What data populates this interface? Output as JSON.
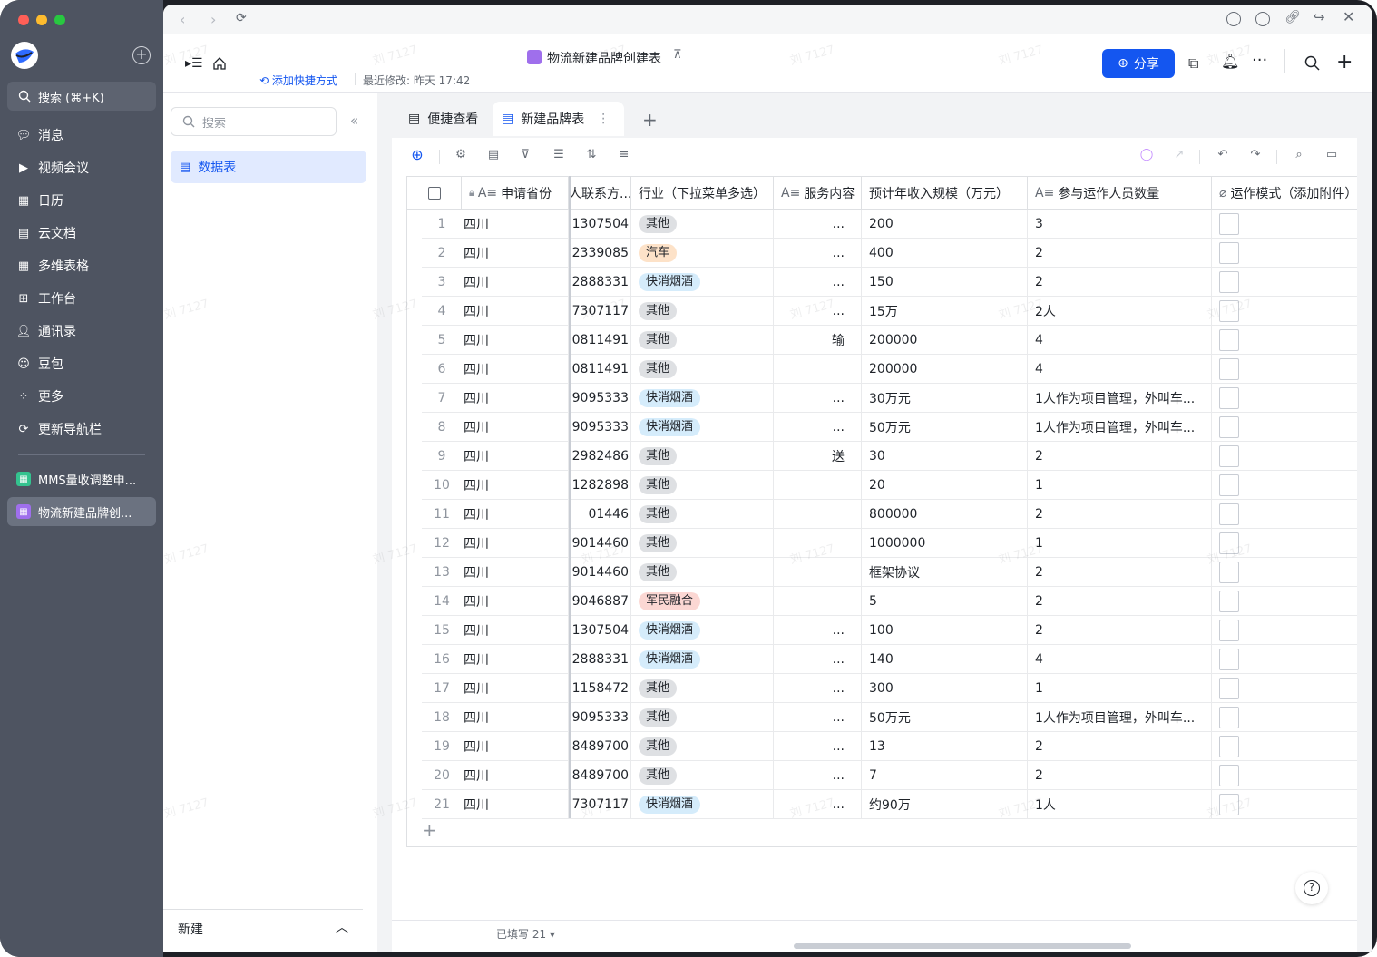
{
  "sidebar": {
    "search_label": "搜索 (⌘+K)",
    "items": [
      {
        "label": "消息",
        "icon": "message-icon"
      },
      {
        "label": "视频会议",
        "icon": "video-icon"
      },
      {
        "label": "日历",
        "icon": "calendar-icon"
      },
      {
        "label": "云文档",
        "icon": "doc-icon"
      },
      {
        "label": "多维表格",
        "icon": "base-icon"
      },
      {
        "label": "工作台",
        "icon": "workplace-icon"
      },
      {
        "label": "通讯录",
        "icon": "contacts-icon"
      },
      {
        "label": "豆包",
        "icon": "doubao-icon"
      },
      {
        "label": "更多",
        "icon": "more-icon"
      },
      {
        "label": "更新导航栏",
        "icon": "refresh-icon"
      }
    ],
    "pinned": [
      {
        "label": "MMS量收调整申...",
        "icon": "sheet-icon"
      },
      {
        "label": "物流新建品牌创...",
        "icon": "base-icon"
      }
    ]
  },
  "header": {
    "add_shortcut": "添加快捷方式",
    "last_modified": "最近修改: 昨天 17:42",
    "doc_title": "物流新建品牌创建表",
    "share_label": "分享"
  },
  "leftpanel": {
    "search_placeholder": "搜索",
    "table_item": "数据表",
    "new_label": "新建"
  },
  "tabs": [
    {
      "label": "便捷查看"
    },
    {
      "label": "新建品牌表"
    }
  ],
  "grid": {
    "columns": {
      "province": "申请省份",
      "contact": "人联系方...",
      "industry": "行业（下拉菜单多选）",
      "service": "服务内容",
      "revenue": "预计年收入规模（万元）",
      "staff": "参与运作人员数量",
      "mode": "运作模式（添加附件）"
    },
    "rows": [
      {
        "n": "1",
        "province": "四川",
        "contact": "1307504",
        "industry": "其他",
        "service": "...",
        "revenue": "200",
        "staff": "3"
      },
      {
        "n": "2",
        "province": "四川",
        "contact": "2339085",
        "industry": "汽车",
        "service": "...",
        "revenue": "400",
        "staff": "2"
      },
      {
        "n": "3",
        "province": "四川",
        "contact": "2888331",
        "industry": "快消烟酒",
        "service": "...",
        "revenue": "150",
        "staff": "2"
      },
      {
        "n": "4",
        "province": "四川",
        "contact": "7307117",
        "industry": "其他",
        "service": "...",
        "revenue": "15万",
        "staff": "2人"
      },
      {
        "n": "5",
        "province": "四川",
        "contact": "0811491",
        "industry": "其他",
        "service": "输",
        "revenue": "200000",
        "staff": "4"
      },
      {
        "n": "6",
        "province": "四川",
        "contact": "0811491",
        "industry": "其他",
        "service": "",
        "revenue": "200000",
        "staff": "4"
      },
      {
        "n": "7",
        "province": "四川",
        "contact": "9095333",
        "industry": "快消烟酒",
        "service": "...",
        "revenue": "30万元",
        "staff": "1人作为项目管理，外叫车..."
      },
      {
        "n": "8",
        "province": "四川",
        "contact": "9095333",
        "industry": "快消烟酒",
        "service": "...",
        "revenue": "50万元",
        "staff": "1人作为项目管理，外叫车..."
      },
      {
        "n": "9",
        "province": "四川",
        "contact": "2982486",
        "industry": "其他",
        "service": "送",
        "revenue": "30",
        "staff": "2"
      },
      {
        "n": "10",
        "province": "四川",
        "contact": "1282898",
        "industry": "其他",
        "service": "",
        "revenue": "20",
        "staff": "1"
      },
      {
        "n": "11",
        "province": "四川",
        "contact": "01446",
        "industry": "其他",
        "service": "",
        "revenue": "800000",
        "staff": "2"
      },
      {
        "n": "12",
        "province": "四川",
        "contact": "9014460",
        "industry": "其他",
        "service": "",
        "revenue": "1000000",
        "staff": "1"
      },
      {
        "n": "13",
        "province": "四川",
        "contact": "9014460",
        "industry": "其他",
        "service": "",
        "revenue": "框架协议",
        "staff": "2"
      },
      {
        "n": "14",
        "province": "四川",
        "contact": "9046887",
        "industry": "军民融合",
        "service": "",
        "revenue": "5",
        "staff": "2"
      },
      {
        "n": "15",
        "province": "四川",
        "contact": "1307504",
        "industry": "快消烟酒",
        "service": "...",
        "revenue": "100",
        "staff": "2"
      },
      {
        "n": "16",
        "province": "四川",
        "contact": "2888331",
        "industry": "快消烟酒",
        "service": "...",
        "revenue": "140",
        "staff": "4"
      },
      {
        "n": "17",
        "province": "四川",
        "contact": "1158472",
        "industry": "其他",
        "service": "...",
        "revenue": "300",
        "staff": "1"
      },
      {
        "n": "18",
        "province": "四川",
        "contact": "9095333",
        "industry": "其他",
        "service": "...",
        "revenue": "50万元",
        "staff": "1人作为项目管理，外叫车..."
      },
      {
        "n": "19",
        "province": "四川",
        "contact": "8489700",
        "industry": "其他",
        "service": "...",
        "revenue": "13",
        "staff": "2"
      },
      {
        "n": "20",
        "province": "四川",
        "contact": "8489700",
        "industry": "其他",
        "service": "...",
        "revenue": "7",
        "staff": "2"
      },
      {
        "n": "21",
        "province": "四川",
        "contact": "7307117",
        "industry": "快消烟酒",
        "service": "...",
        "revenue": "约90万",
        "staff": "1人"
      }
    ],
    "add_row": "+",
    "footer_count": "已填写 21"
  },
  "tag_colors": {
    "其他": {
      "bg": "#dee0e3",
      "fg": "#1f2329"
    },
    "汽车": {
      "bg": "#fde2c8",
      "fg": "#1f2329"
    },
    "快消烟酒": {
      "bg": "#d5ecfb",
      "fg": "#1f2329"
    },
    "军民融合": {
      "bg": "#fbd7d3",
      "fg": "#1f2329"
    }
  },
  "watermark": "刘 7127",
  "colors": {
    "accent": "#1456f0",
    "sidebar": "#4e5461"
  }
}
